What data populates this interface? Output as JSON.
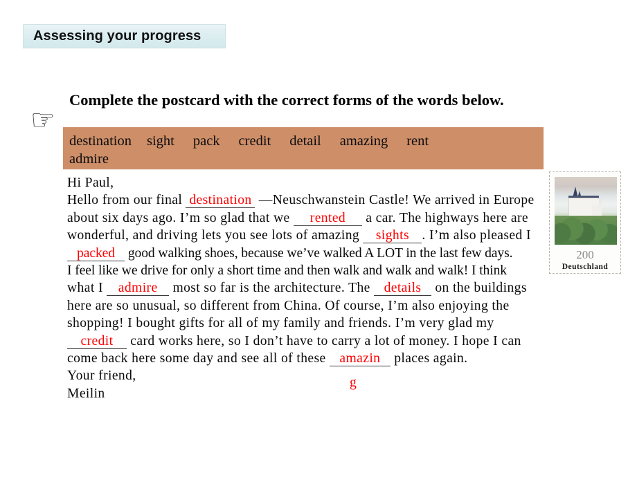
{
  "header": {
    "banner_title": "Assessing your progress",
    "banner_bg": "#dceef1"
  },
  "instruction": {
    "pointer_icon": "☞",
    "text": "Complete the postcard with the correct forms of the words below."
  },
  "word_bank": {
    "bg_color": "#cd8e68",
    "line1": [
      "destination",
      "sight",
      "pack",
      "credit",
      "detail",
      "amazing",
      "rent"
    ],
    "line2": [
      "admire"
    ]
  },
  "postcard": {
    "answer_color": "#ff0000",
    "greeting": "Hi Paul,",
    "line2_a": "Hello from our final",
    "ans_destination": "destination",
    "line2_b": "—Neuschwanstein Castle! We arrived in Europe",
    "line3_a": "about six days ago. I’m so glad that we",
    "ans_rented": "rented",
    "line3_b": "a car. The highways here are",
    "line4_a": "wonderful, and driving lets you see lots of amazing",
    "ans_sights": "sights",
    "line4_b": ". I’m also pleased I",
    "ans_packed": "packed",
    "line5_b": "good walking shoes, because we’ve walked A LOT in the last few days.",
    "line6": "I feel like we drive for only a short time and then walk and walk and walk! I think",
    "line7_a": "what I",
    "ans_admire": "admire",
    "line7_b": "most so far is the architecture. The",
    "ans_details": "details",
    "line7_c": "on the buildings",
    "line8": "here are so unusual, so different from China. Of course, I’m also enjoying the",
    "line9": "shopping! I bought gifts for all of my family and friends. I’m very glad my",
    "ans_credit": "credit",
    "line10_b": "card works here, so I don’t have to carry a lot of money. I hope I can",
    "line11_a": "come back here some day and see all of these",
    "ans_amazing": "amazin",
    "ans_amazing_orphan": "g",
    "line11_b": "places again.",
    "signoff": "Your friend,",
    "signature": "Meilin"
  },
  "stamp": {
    "value": "200",
    "country": "Deutschland",
    "subject": "Neuschwanstein Castle"
  }
}
